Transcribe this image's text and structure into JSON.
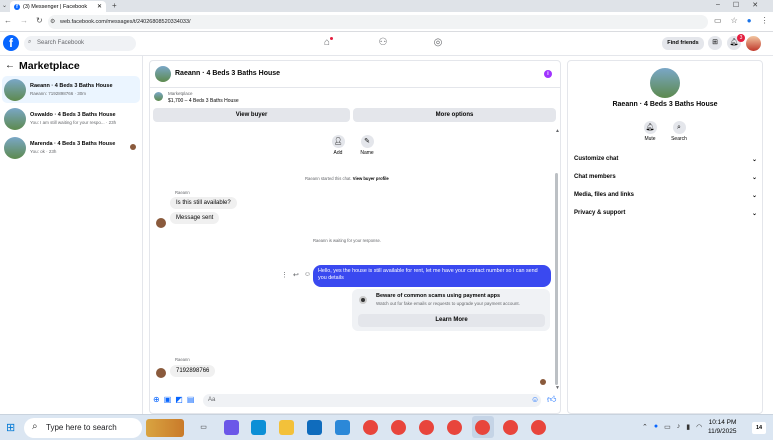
{
  "browser": {
    "tab_title": "(3) Messenger | Facebook",
    "url": "web.facebook.com/messages/t/24026808520334033/",
    "new_tab": "+",
    "window_controls": [
      "–",
      "☐",
      "✕"
    ]
  },
  "facebook": {
    "logo": "f",
    "search_placeholder": "Search Facebook",
    "find_friends": "Find friends",
    "notification_count": "3"
  },
  "sidebar": {
    "title": "Marketplace",
    "conversations": [
      {
        "name": "Raeann · 4 Beds 3 Baths House",
        "preview": "Raeann: 7192898766 · 30m"
      },
      {
        "name": "Oswaldo · 4 Beds 3 Baths House",
        "preview": "You: I am still waiting for your respo... · 23h"
      },
      {
        "name": "Marenda · 4 Beds 3 Baths House",
        "preview": "You: ok · 23h"
      }
    ]
  },
  "chat": {
    "title": "Raeann · 4 Beds 3 Baths House",
    "listing_label": "Marketplace",
    "listing_detail": "$1,700 – 4 Beds 3 Baths House",
    "view_buyer": "View buyer",
    "more_options": "More options",
    "tools": [
      {
        "label": "Add",
        "icon": "person-add-icon"
      },
      {
        "label": "Name",
        "icon": "pencil-icon"
      }
    ],
    "system_started": "Raeann started this chat.",
    "view_buyer_profile": "View buyer profile",
    "sender_name_1": "Raeann",
    "msg_1": "Is this still available?",
    "msg_2": "Message sent",
    "system_waiting": "Raeann is waiting for your response.",
    "outgoing": "Hello, yes the house is still available for rent, let me have your contact number so i can send you  details",
    "warning_title": "Beware of common scams using payment apps",
    "warning_text": "Watch out for fake emails or requests to upgrade your payment account.",
    "learn_more": "Learn More",
    "sender_name_2": "Raeann",
    "msg_3": "7192898766",
    "composer_placeholder": "Aa"
  },
  "details": {
    "title": "Raeann · 4 Beds 3 Baths House",
    "mute": "Mute",
    "search": "Search",
    "options": [
      "Customize chat",
      "Chat members",
      "Media, files and links",
      "Privacy & support"
    ]
  },
  "taskbar": {
    "search_placeholder": "Type here to search",
    "time": "10:14 PM",
    "date": "11/9/2025",
    "notification_badge": "14"
  }
}
